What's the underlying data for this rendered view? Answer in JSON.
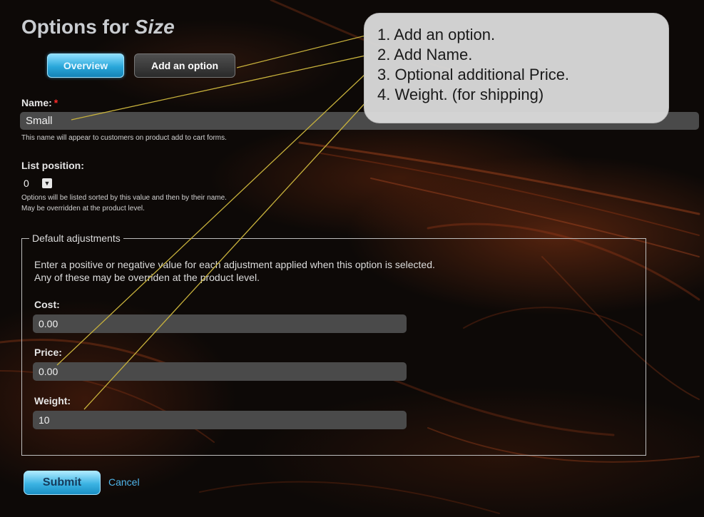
{
  "page": {
    "title_prefix": "Options for",
    "title_subject": "Size"
  },
  "tabs": [
    {
      "label": "Overview",
      "active": true
    },
    {
      "label": "Add an option",
      "active": false
    }
  ],
  "name_field": {
    "label": "Name:",
    "required_mark": "*",
    "value": "Small",
    "hint": "This name will appear to customers on product add to cart forms."
  },
  "list_position": {
    "label": "List position:",
    "value": "0",
    "hint_line1": "Options will be listed sorted by this value and then by their name.",
    "hint_line2": "May be overridden at the product level."
  },
  "adjustments": {
    "legend": "Default adjustments",
    "description_line1": "Enter a positive or negative value for each adjustment applied when this option is selected.",
    "description_line2": "Any of these may be overriden at the product level.",
    "cost": {
      "label": "Cost:",
      "value": "0.00"
    },
    "price": {
      "label": "Price:",
      "value": "0.00"
    },
    "weight": {
      "label": "Weight:",
      "value": "10"
    }
  },
  "actions": {
    "submit_label": "Submit",
    "cancel_label": "Cancel"
  },
  "callout": {
    "lines": [
      "1. Add an option.",
      "2. Add Name.",
      "3. Optional additional Price.",
      "4. Weight. (for shipping)"
    ]
  },
  "colors": {
    "background": "#0d0907",
    "accent_blue": "#2aa7da",
    "link_blue": "#4fb5ea",
    "field_gray": "#4a4a4a",
    "required_red": "#ff2a2a",
    "annotation_line": "#c8b23c",
    "callout_bg": "#d8d8d8"
  },
  "icons": {
    "select_arrow": "chevron-down-icon"
  }
}
